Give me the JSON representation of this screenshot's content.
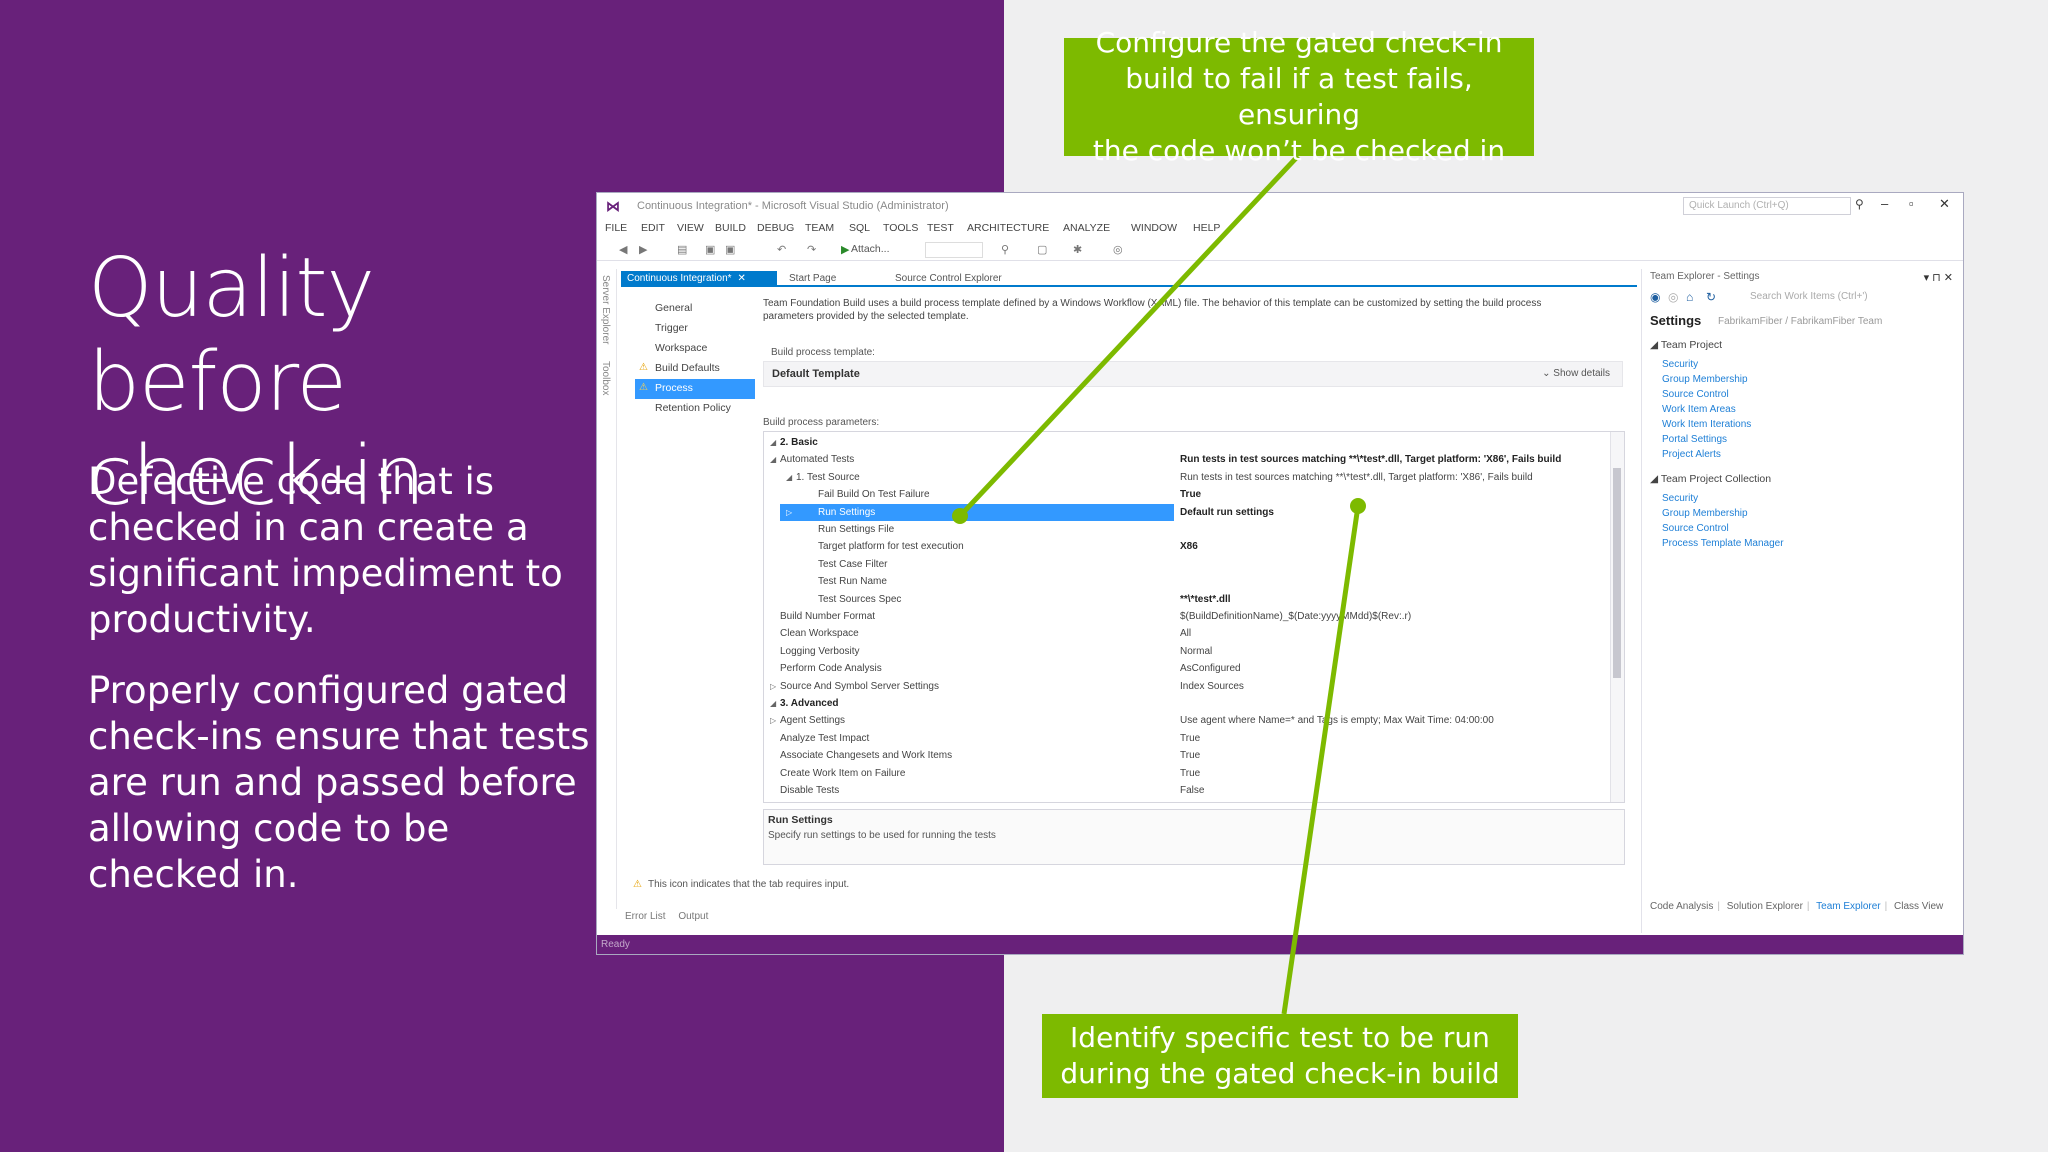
{
  "slide": {
    "title_line1": "Quality before",
    "title_line2": "check-in",
    "para1": "Defective code that is checked in can create a significant impediment to productivity.",
    "para2": "Properly configured gated check-ins ensure that tests are run and passed before allowing code to be checked in.",
    "callout_top": "Configure the gated check-in\nbuild to fail if a test fails, ensuring\nthe code won’t be checked in",
    "callout_bottom": "Identify specific test to be run\nduring the gated check-in build",
    "colors": {
      "background": "#68217a",
      "callout": "#7dba00",
      "right_bg": "#efeff0"
    }
  },
  "vs": {
    "window_title": "Continuous Integration* - Microsoft Visual Studio (Administrator)",
    "quick_launch_placeholder": "Quick Launch (Ctrl+Q)",
    "menu": [
      "FILE",
      "EDIT",
      "VIEW",
      "BUILD",
      "DEBUG",
      "TEAM",
      "SQL",
      "TOOLS",
      "TEST",
      "ARCHITECTURE",
      "ANALYZE",
      "WINDOW",
      "HELP"
    ],
    "toolbar_attach": "Attach...",
    "side_tabs": [
      "Server Explorer",
      "Toolbox"
    ],
    "doc_tabs": [
      "Continuous Integration*",
      "Start Page",
      "Source Control Explorer"
    ],
    "nav_items": [
      "General",
      "Trigger",
      "Workspace",
      "Build Defaults",
      "Process",
      "Retention Policy"
    ],
    "description": "Team Foundation Build uses a build process template defined by a Windows Workflow (XAML) file. The behavior of this template can be customized by setting the build process parameters provided by the selected template.",
    "template_label": "Build process template:",
    "template_name": "Default Template",
    "show_details": "Show details",
    "params_label": "Build process parameters:",
    "params": [
      {
        "name": "2. Basic",
        "value": ""
      },
      {
        "name": "Automated Tests",
        "value": "Run tests in test sources matching **\\*test*.dll, Target platform: 'X86', Fails build"
      },
      {
        "name": "1. Test Source",
        "value": "Run tests in test sources matching **\\*test*.dll, Target platform: 'X86', Fails build"
      },
      {
        "name": "Fail Build On Test Failure",
        "value": "True"
      },
      {
        "name": "Run Settings",
        "value": "Default run settings"
      },
      {
        "name": "Run Settings File",
        "value": ""
      },
      {
        "name": "Target platform for test execution",
        "value": "X86"
      },
      {
        "name": "Test Case Filter",
        "value": ""
      },
      {
        "name": "Test Run Name",
        "value": ""
      },
      {
        "name": "Test Sources Spec",
        "value": "**\\*test*.dll"
      },
      {
        "name": "Build Number Format",
        "value": "$(BuildDefinitionName)_$(Date:yyyyMMdd)$(Rev:.r)"
      },
      {
        "name": "Clean Workspace",
        "value": "All"
      },
      {
        "name": "Logging Verbosity",
        "value": "Normal"
      },
      {
        "name": "Perform Code Analysis",
        "value": "AsConfigured"
      },
      {
        "name": "Source And Symbol Server Settings",
        "value": "Index Sources"
      },
      {
        "name": "3. Advanced",
        "value": ""
      },
      {
        "name": "Agent Settings",
        "value": "Use agent where Name=* and Tags is empty; Max Wait Time: 04:00:00"
      },
      {
        "name": "Analyze Test Impact",
        "value": "True"
      },
      {
        "name": "Associate Changesets and Work Items",
        "value": "True"
      },
      {
        "name": "Create Work Item on Failure",
        "value": "True"
      },
      {
        "name": "Disable Tests",
        "value": "False"
      }
    ],
    "help_title": "Run Settings",
    "help_desc": "Specify run settings to be used for running the tests",
    "footnote": "This icon indicates that the tab requires input.",
    "bottom_tabs": [
      "Error List",
      "Output"
    ],
    "status": "Ready"
  },
  "team_explorer": {
    "header": "Team Explorer - Settings",
    "search_placeholder": "Search Work Items (Ctrl+')",
    "title": "Settings",
    "subtitle": "FabrikamFiber / FabrikamFiber Team",
    "team_project": "Team Project",
    "team_project_links": [
      "Security",
      "Group Membership",
      "Source Control",
      "Work Item Areas",
      "Work Item Iterations",
      "Portal Settings",
      "Project Alerts"
    ],
    "collection": "Team Project Collection",
    "collection_links": [
      "Security",
      "Group Membership",
      "Source Control",
      "Process Template Manager"
    ],
    "bottom_tabs": [
      "Code Analysis",
      "Solution Explorer",
      "Team Explorer",
      "Class View"
    ]
  }
}
